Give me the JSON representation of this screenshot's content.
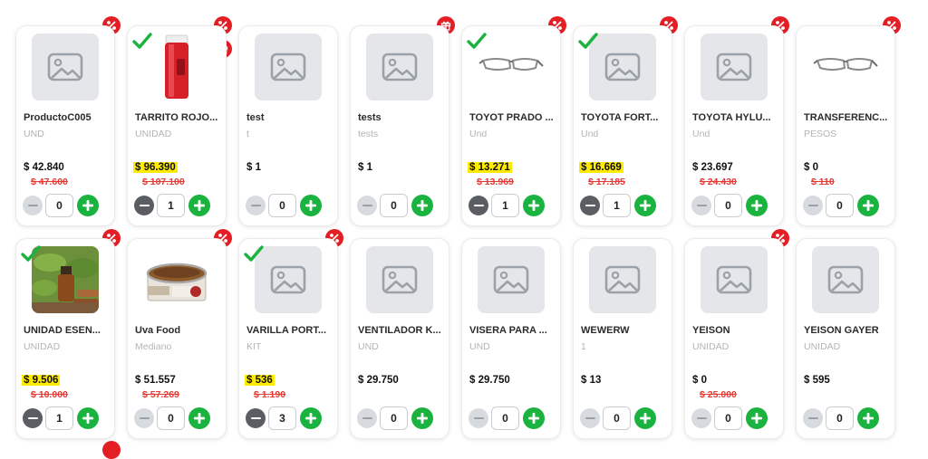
{
  "colors": {
    "discount_badge": "#e31e24",
    "add_button": "#1bb33f",
    "old_price": "#e53935",
    "price_highlight": "#ffeb00",
    "check": "#1bb33f"
  },
  "products": [
    {
      "name": "ProductoC005",
      "unit": "UND",
      "price": "$ 42.840",
      "old_price": "$ 47.600",
      "qty": "0",
      "highlight": false,
      "selected": false,
      "image": "placeholder-icon",
      "badges": [
        "discount-badge-icon"
      ]
    },
    {
      "name": "TARRITO ROJO...",
      "unit": "UNIDAD",
      "price": "$ 96.390",
      "old_price": "$ 107.100",
      "qty": "1",
      "highlight": true,
      "selected": true,
      "image": "red-jar-image",
      "badges": [
        "discount-badge-icon",
        "gift-badge-icon"
      ]
    },
    {
      "name": "test",
      "unit": "t",
      "price": "$ 1",
      "old_price": "",
      "qty": "0",
      "highlight": false,
      "selected": false,
      "image": "placeholder-icon",
      "badges": []
    },
    {
      "name": "tests",
      "unit": "tests",
      "price": "$ 1",
      "old_price": "",
      "qty": "0",
      "highlight": false,
      "selected": false,
      "image": "placeholder-icon",
      "badges": [
        "gift-badge-icon"
      ]
    },
    {
      "name": "TOYOT PRADO ...",
      "unit": "Und",
      "price": "$ 13.271",
      "old_price": "$ 13.969",
      "qty": "1",
      "highlight": true,
      "selected": true,
      "image": "eyeglasses-image",
      "badges": [
        "discount-badge-icon"
      ]
    },
    {
      "name": "TOYOTA FORT...",
      "unit": "Und",
      "price": "$ 16.669",
      "old_price": "$ 17.185",
      "qty": "1",
      "highlight": true,
      "selected": true,
      "image": "placeholder-icon",
      "badges": [
        "discount-badge-icon"
      ]
    },
    {
      "name": "TOYOTA HYLU...",
      "unit": "Und",
      "price": "$ 23.697",
      "old_price": "$ 24.430",
      "qty": "0",
      "highlight": false,
      "selected": false,
      "image": "placeholder-icon",
      "badges": [
        "discount-badge-icon"
      ]
    },
    {
      "name": "TRANSFERENC...",
      "unit": "PESOS",
      "price": "$ 0",
      "old_price": "$ 110",
      "qty": "0",
      "highlight": false,
      "selected": false,
      "image": "eyeglasses-image",
      "badges": [
        "discount-badge-icon"
      ]
    },
    {
      "name": "UNIDAD ESEN...",
      "unit": "UNIDAD",
      "price": "$ 9.506",
      "old_price": "$ 10.000",
      "qty": "1",
      "highlight": true,
      "selected": true,
      "image": "essential-oil-image",
      "badges": [
        "discount-badge-icon"
      ]
    },
    {
      "name": "Uva Food",
      "unit": "Mediano",
      "price": "$ 51.557",
      "old_price": "$ 57.269",
      "qty": "0",
      "highlight": false,
      "selected": false,
      "image": "pet-food-can-image",
      "badges": [
        "discount-badge-icon"
      ]
    },
    {
      "name": "VARILLA PORT...",
      "unit": "KIT",
      "price": "$ 536",
      "old_price": "$ 1.190",
      "qty": "3",
      "highlight": true,
      "selected": true,
      "image": "placeholder-icon",
      "badges": [
        "discount-badge-icon"
      ]
    },
    {
      "name": "VENTILADOR K...",
      "unit": "UND",
      "price": "$ 29.750",
      "old_price": "",
      "qty": "0",
      "highlight": false,
      "selected": false,
      "image": "placeholder-icon",
      "badges": []
    },
    {
      "name": "VISERA PARA ...",
      "unit": "UND",
      "price": "$ 29.750",
      "old_price": "",
      "qty": "0",
      "highlight": false,
      "selected": false,
      "image": "placeholder-icon",
      "badges": []
    },
    {
      "name": "WEWERW",
      "unit": "1",
      "price": "$ 13",
      "old_price": "",
      "qty": "0",
      "highlight": false,
      "selected": false,
      "image": "placeholder-icon",
      "badges": []
    },
    {
      "name": "YEISON",
      "unit": "UNIDAD",
      "price": "$ 0",
      "old_price": "$ 25.000",
      "qty": "0",
      "highlight": false,
      "selected": false,
      "image": "placeholder-icon",
      "badges": [
        "discount-badge-icon"
      ]
    },
    {
      "name": "YEISON GAYER",
      "unit": "UNIDAD",
      "price": "$ 595",
      "old_price": "",
      "qty": "0",
      "highlight": false,
      "selected": false,
      "image": "placeholder-icon",
      "badges": []
    }
  ]
}
